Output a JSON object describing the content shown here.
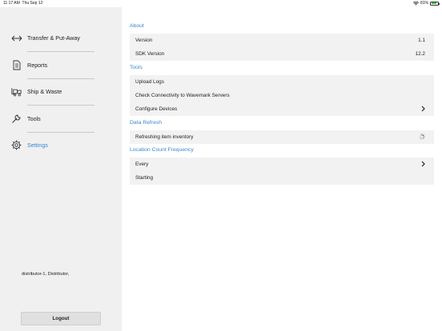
{
  "status_bar": {
    "time": "11:17 AM",
    "date": "Thu Sep 12",
    "battery": "81%",
    "battery_level": 0.81
  },
  "sidebar": {
    "items": [
      {
        "label": "Transfer & Put-Away",
        "icon": "transfer-arrows-icon"
      },
      {
        "label": "Reports",
        "icon": "document-icon"
      },
      {
        "label": "Ship & Waste",
        "icon": "forklift-icon"
      },
      {
        "label": "Tools",
        "icon": "wrench-icon"
      },
      {
        "label": "Settings",
        "icon": "gear-icon",
        "active": true
      }
    ],
    "user_info": "distributor-1, Distributor,",
    "logout_label": "Logout"
  },
  "settings": {
    "about": {
      "header": "About",
      "version_label": "Version",
      "version_value": "1.1",
      "sdk_label": "SDK Version",
      "sdk_value": "12.2"
    },
    "tools": {
      "header": "Tools",
      "upload_logs": "Upload Logs",
      "check_connectivity": "Check Connectivity to Wavemark Servers",
      "configure_devices": "Configure Devices"
    },
    "data_refresh": {
      "header": "Data Refresh",
      "refreshing": "Refreshing item inventory"
    },
    "location_count": {
      "header": "Location Count Frequency",
      "every": "Every",
      "starting": "Starting"
    }
  },
  "colors": {
    "accent": "#3a86d4",
    "sidebar_bg": "#f0f0f0",
    "row_bg": "#f2f2f2",
    "battery": "#3cc23c"
  }
}
